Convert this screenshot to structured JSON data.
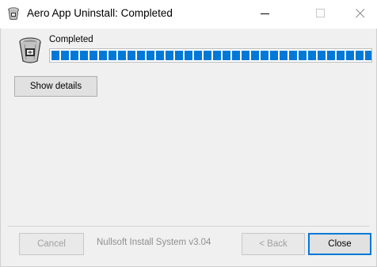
{
  "window": {
    "title": "Aero App Uninstall: Completed",
    "controls": {
      "minimize": "minimize",
      "maximize": "maximize",
      "close": "close"
    }
  },
  "header": {
    "status": "Completed"
  },
  "progress": {
    "percent": 100,
    "color": "#0078d7"
  },
  "buttons": {
    "show_details": "Show details",
    "cancel": "Cancel",
    "back": "< Back",
    "close": "Close"
  },
  "branding": {
    "text": "Nullsoft Install System v3.04"
  },
  "icons": {
    "app": "recycle-bin-icon"
  },
  "colors": {
    "accent": "#0078d7",
    "window_bg": "#f0f0f0"
  }
}
